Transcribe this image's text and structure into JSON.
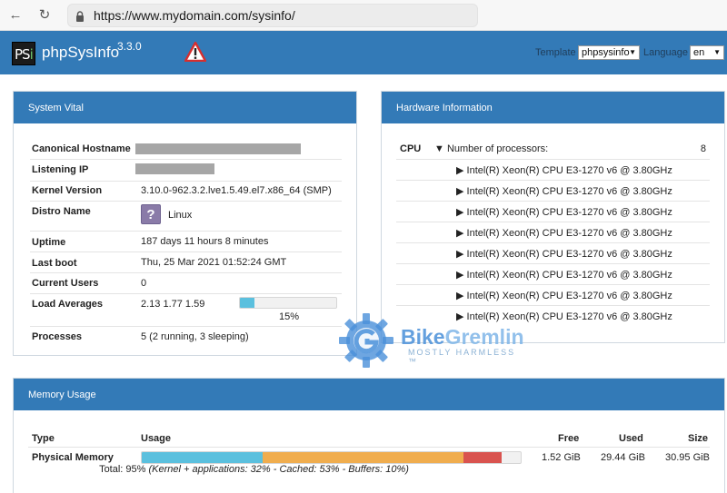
{
  "browser": {
    "url": "https://www.mydomain.com/sysinfo/",
    "back_icon": "←",
    "reload_icon": "↻"
  },
  "app": {
    "logo_p": "PS",
    "logo_i": "i",
    "name": "phpSysInfo",
    "version": "3.3.0",
    "template_label": "Template",
    "template_value": "phpsysinfo",
    "language_label": "Language",
    "language_value": "en"
  },
  "system_vital": {
    "title": "System Vital",
    "rows": [
      {
        "label": "Canonical Hostname",
        "value": ""
      },
      {
        "label": "Listening IP",
        "value": ""
      },
      {
        "label": "Kernel Version",
        "value": "3.10.0-962.3.2.lve1.5.49.el7.x86_64 (SMP)"
      },
      {
        "label": "Distro Name",
        "value": "Linux"
      },
      {
        "label": "Uptime",
        "value": "187 days 11 hours 8 minutes"
      },
      {
        "label": "Last boot",
        "value": "Thu, 25 Mar 2021 01:52:24 GMT"
      },
      {
        "label": "Current Users",
        "value": "0"
      },
      {
        "label": "Load Averages",
        "value": "2.13 1.77 1.59"
      },
      {
        "label": "Processes",
        "value": "5 (2 running, 3 sleeping)"
      }
    ],
    "load_percent_label": "15%",
    "load_fraction": 0.15,
    "distro_icon": "?"
  },
  "hardware": {
    "title": "Hardware Information",
    "cpu_label": "CPU",
    "processors_label": "▼ Number of processors:",
    "processors_count": "8",
    "cpus": [
      "▶ Intel(R) Xeon(R) CPU E3-1270 v6 @ 3.80GHz",
      "▶ Intel(R) Xeon(R) CPU E3-1270 v6 @ 3.80GHz",
      "▶ Intel(R) Xeon(R) CPU E3-1270 v6 @ 3.80GHz",
      "▶ Intel(R) Xeon(R) CPU E3-1270 v6 @ 3.80GHz",
      "▶ Intel(R) Xeon(R) CPU E3-1270 v6 @ 3.80GHz",
      "▶ Intel(R) Xeon(R) CPU E3-1270 v6 @ 3.80GHz",
      "▶ Intel(R) Xeon(R) CPU E3-1270 v6 @ 3.80GHz",
      "▶ Intel(R) Xeon(R) CPU E3-1270 v6 @ 3.80GHz"
    ]
  },
  "memory": {
    "title": "Memory Usage",
    "headers": {
      "type": "Type",
      "usage": "Usage",
      "free": "Free",
      "used": "Used",
      "size": "Size"
    },
    "row": {
      "type": "Physical Memory",
      "free": "1.52 GiB",
      "used": "29.44 GiB",
      "size": "30.95 GiB",
      "summary_prefix": "Total: 95% ",
      "summary_detail": "(Kernel + applications: 32% - Cached: 53% - Buffers: 10%)"
    },
    "segments": [
      {
        "name": "kernel-applications",
        "percent": 32,
        "color": "#5bc0de"
      },
      {
        "name": "cached",
        "percent": 53,
        "color": "#f0ad4e"
      },
      {
        "name": "buffers",
        "percent": 10,
        "color": "#d9534f"
      }
    ]
  },
  "watermark": {
    "brand_a": "Bike",
    "brand_b": "Gremlin",
    "tagline": "MOSTLY HARMLESS ™"
  },
  "colors": {
    "header_blue": "#337ab7",
    "warning_red": "#d62f2f"
  }
}
